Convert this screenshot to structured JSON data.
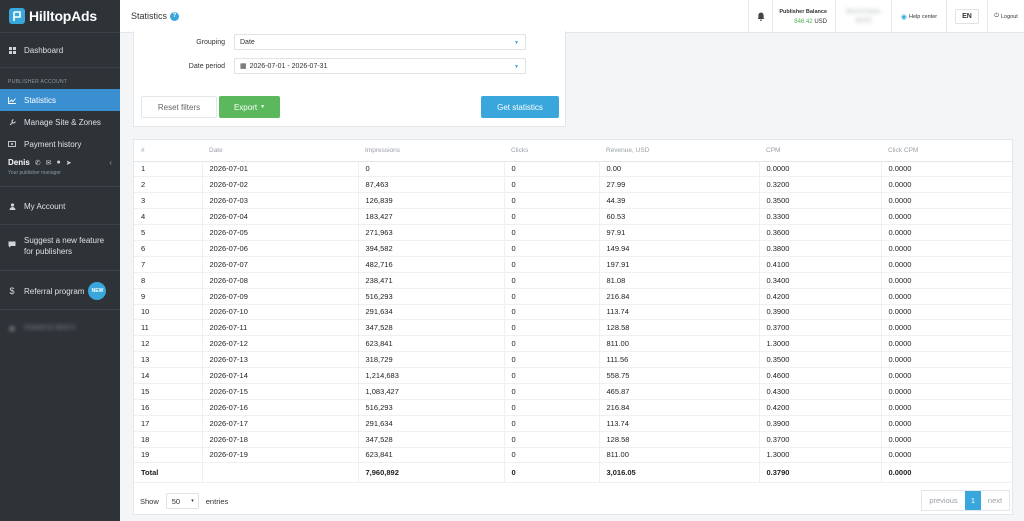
{
  "brand": {
    "name": "HilltopAds"
  },
  "sidebar": {
    "dashboard": "Dashboard",
    "section": "PUBLISHER ACCOUNT",
    "items": [
      {
        "label": "Statistics",
        "icon": "chart-icon"
      },
      {
        "label": "Manage Site & Zones",
        "icon": "wrench-icon"
      },
      {
        "label": "Payment history",
        "icon": "money-icon"
      }
    ],
    "manager_name": "Denis",
    "manager_role": "Your publisher manager",
    "my_account": "My Account",
    "suggest_line1": "Suggest a new feature",
    "suggest_line2": "for publishers",
    "referral": "Referral program",
    "referral_badge": "NEW",
    "account_id": "Account ID 361975"
  },
  "header": {
    "title": "Statistics",
    "balance_label": "Publisher Balance",
    "balance_amount": "846.42",
    "balance_currency": "USD",
    "user_name": "Blurred Name",
    "user_sub": "361975",
    "help_center": "Help center",
    "lang": "EN",
    "logout": "Logout"
  },
  "filters": {
    "grouping_label": "Grouping",
    "grouping_value": "Date",
    "period_label": "Date period",
    "period_value": "2026-07-01 - 2026-07-31",
    "reset": "Reset filters",
    "export": "Export",
    "get_stats": "Get statistics"
  },
  "table": {
    "headers": [
      "#",
      "Date",
      "Impressions",
      "Clicks",
      "Revenue, USD",
      "CPM",
      "Click CPM"
    ],
    "rows": [
      [
        "1",
        "2026-07-01",
        "0",
        "0",
        "0.00",
        "0.0000",
        "0.0000"
      ],
      [
        "2",
        "2026-07-02",
        "87,463",
        "0",
        "27.99",
        "0.3200",
        "0.0000"
      ],
      [
        "3",
        "2026-07-03",
        "126,839",
        "0",
        "44.39",
        "0.3500",
        "0.0000"
      ],
      [
        "4",
        "2026-07-04",
        "183,427",
        "0",
        "60.53",
        "0.3300",
        "0.0000"
      ],
      [
        "5",
        "2026-07-05",
        "271,963",
        "0",
        "97.91",
        "0.3600",
        "0.0000"
      ],
      [
        "6",
        "2026-07-06",
        "394,582",
        "0",
        "149.94",
        "0.3800",
        "0.0000"
      ],
      [
        "7",
        "2026-07-07",
        "482,716",
        "0",
        "197.91",
        "0.4100",
        "0.0000"
      ],
      [
        "8",
        "2026-07-08",
        "238,471",
        "0",
        "81.08",
        "0.3400",
        "0.0000"
      ],
      [
        "9",
        "2026-07-09",
        "516,293",
        "0",
        "216.84",
        "0.4200",
        "0.0000"
      ],
      [
        "10",
        "2026-07-10",
        "291,634",
        "0",
        "113.74",
        "0.3900",
        "0.0000"
      ],
      [
        "11",
        "2026-07-11",
        "347,528",
        "0",
        "128.58",
        "0.3700",
        "0.0000"
      ],
      [
        "12",
        "2026-07-12",
        "623,841",
        "0",
        "811.00",
        "1.3000",
        "0.0000"
      ],
      [
        "13",
        "2026-07-13",
        "318,729",
        "0",
        "111.56",
        "0.3500",
        "0.0000"
      ],
      [
        "14",
        "2026-07-14",
        "1,214,683",
        "0",
        "558.75",
        "0.4600",
        "0.0000"
      ],
      [
        "15",
        "2026-07-15",
        "1,083,427",
        "0",
        "465.87",
        "0.4300",
        "0.0000"
      ],
      [
        "16",
        "2026-07-16",
        "516,293",
        "0",
        "216.84",
        "0.4200",
        "0.0000"
      ],
      [
        "17",
        "2026-07-17",
        "291,634",
        "0",
        "113.74",
        "0.3900",
        "0.0000"
      ],
      [
        "18",
        "2026-07-18",
        "347,528",
        "0",
        "128.58",
        "0.3700",
        "0.0000"
      ],
      [
        "19",
        "2026-07-19",
        "623,841",
        "0",
        "811.00",
        "1.3000",
        "0.0000"
      ]
    ],
    "total": [
      "Total",
      "",
      "7,960,892",
      "0",
      "3,016.05",
      "0.3790",
      "0.0000"
    ]
  },
  "pagination": {
    "show": "Show",
    "per_page": "50",
    "entries": "entries",
    "previous": "previous",
    "current": "1",
    "next": "next"
  },
  "colors": {
    "accent": "#39a7dc",
    "export_green": "#5cb85c",
    "active_nav": "#3a8fd0",
    "sidebar_bg": "#2e3338",
    "balance_green": "#4caf50"
  }
}
